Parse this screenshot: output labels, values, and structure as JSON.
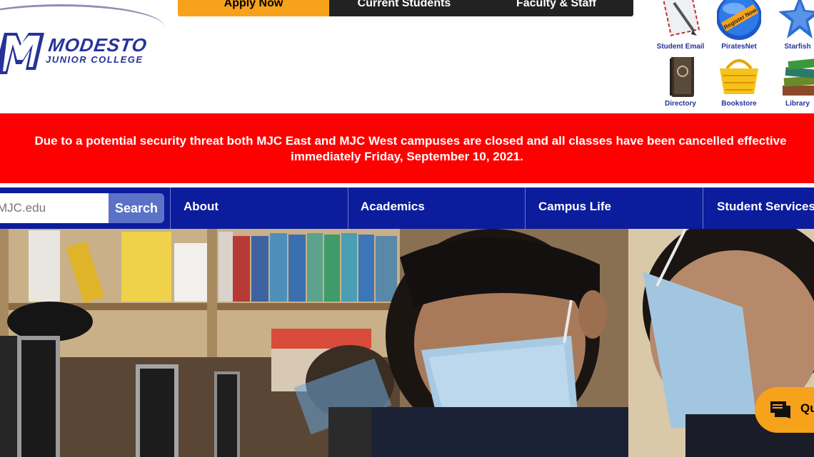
{
  "header": {
    "logo_name": "MODESTO",
    "logo_sub": "JUNIOR COLLEGE",
    "logo_mark": "MJC"
  },
  "topnav": {
    "apply": "Apply Now",
    "current_students": "Current Students",
    "faculty_staff": "Faculty & Staff"
  },
  "quick_links": [
    {
      "label": "Student Email",
      "icon": "envelope-pen-icon"
    },
    {
      "label": "PiratesNet",
      "icon": "register-now-globe-icon"
    },
    {
      "label": "Starfish",
      "icon": "starfish-icon"
    },
    {
      "label": "Directory",
      "icon": "address-book-icon"
    },
    {
      "label": "Bookstore",
      "icon": "shopping-basket-icon"
    },
    {
      "label": "Library",
      "icon": "books-stack-icon"
    }
  ],
  "alert": {
    "line1": "Due to a potential security threat both MJC East and MJC West campuses are closed and all classes have been cancelled effective",
    "line2": "immediately Friday, September 10, 2021."
  },
  "search": {
    "placeholder": "MJC.edu",
    "button": "Search"
  },
  "nav": {
    "about": "About",
    "academics": "Academics",
    "campus_life": "Campus Life",
    "student_services": "Student Services"
  },
  "chat": {
    "label": "Qu"
  },
  "colors": {
    "brand_blue": "#0b1c9c",
    "accent_orange": "#f7a21b",
    "alert_red": "#fe0000",
    "search_button": "#5b72c7"
  }
}
